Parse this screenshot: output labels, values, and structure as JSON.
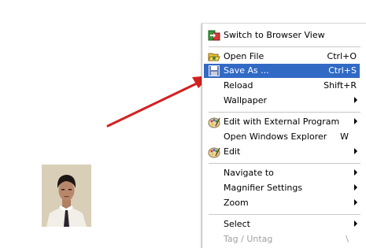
{
  "menu": {
    "items": [
      {
        "label": "Switch to Browser View",
        "shortcut": "",
        "submenu": false,
        "icon": "switch-view-icon"
      },
      {
        "label": "Open File",
        "shortcut": "Ctrl+O",
        "submenu": false,
        "icon": "open-folder-icon"
      },
      {
        "label": "Save As ...",
        "shortcut": "Ctrl+S",
        "submenu": false,
        "icon": "floppy-disk-icon",
        "selected": true
      },
      {
        "label": "Reload",
        "shortcut": "Shift+R",
        "submenu": false,
        "icon": ""
      },
      {
        "label": "Wallpaper",
        "shortcut": "",
        "submenu": true,
        "icon": ""
      },
      {
        "label": "Edit with External Program",
        "shortcut": "",
        "submenu": true,
        "icon": "paint-palette-icon"
      },
      {
        "label": "Open Windows Explorer",
        "shortcut": "W",
        "submenu": false,
        "icon": ""
      },
      {
        "label": "Edit",
        "shortcut": "",
        "submenu": true,
        "icon": "paint-palette-icon"
      },
      {
        "label": "Navigate to",
        "shortcut": "",
        "submenu": true,
        "icon": ""
      },
      {
        "label": "Magnifier Settings",
        "shortcut": "",
        "submenu": true,
        "icon": ""
      },
      {
        "label": "Zoom",
        "shortcut": "",
        "submenu": true,
        "icon": ""
      },
      {
        "label": "Select",
        "shortcut": "",
        "submenu": true,
        "icon": ""
      },
      {
        "label": "Tag / Untag",
        "shortcut": "\\",
        "submenu": false,
        "icon": "",
        "disabled": true
      }
    ]
  },
  "colors": {
    "selection": "#316ac5",
    "arrow": "#d42020",
    "disabled_text": "#a0a0a0"
  }
}
